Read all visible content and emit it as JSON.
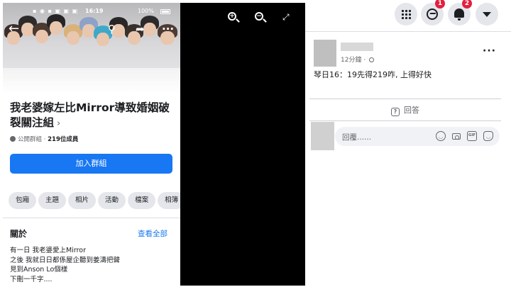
{
  "phone": {
    "status_time": "16:19",
    "status_battery": "100%",
    "group_name": "我老婆嫁左比Mirror導致婚姻破裂關注組",
    "group_name_chevron": "›",
    "group_privacy": "公開群組 · ",
    "group_members": "219位成員",
    "join_button": "加入群組",
    "chips": [
      "包廂",
      "主題",
      "相片",
      "活動",
      "檔案",
      "相簿"
    ],
    "about_title": "關於",
    "about_see_all": "查看全部",
    "about_lines": [
      "有一日 我老婆愛上Mirror",
      "之後 我就日日都係屋企聽到姜濤把聲",
      "見到Anson Lo個樣",
      "下刪一千字...."
    ]
  },
  "viewer": {
    "zoom_in_icon": "zoom-in-icon",
    "zoom_out_icon": "zoom-out-icon",
    "fullscreen_icon": "fullscreen-icon"
  },
  "panel": {
    "messenger_badge": "1",
    "notifications_badge": "2",
    "post_time": "12分鐘 · ",
    "post_text": "琴日16：19先得219咋, 上得好快",
    "reply_label": "回答",
    "comment_placeholder": "回覆......"
  },
  "colors": {
    "facebook_blue": "#1877f2",
    "badge_red": "#e41e3f",
    "chip_bg": "#e4e6eb"
  }
}
